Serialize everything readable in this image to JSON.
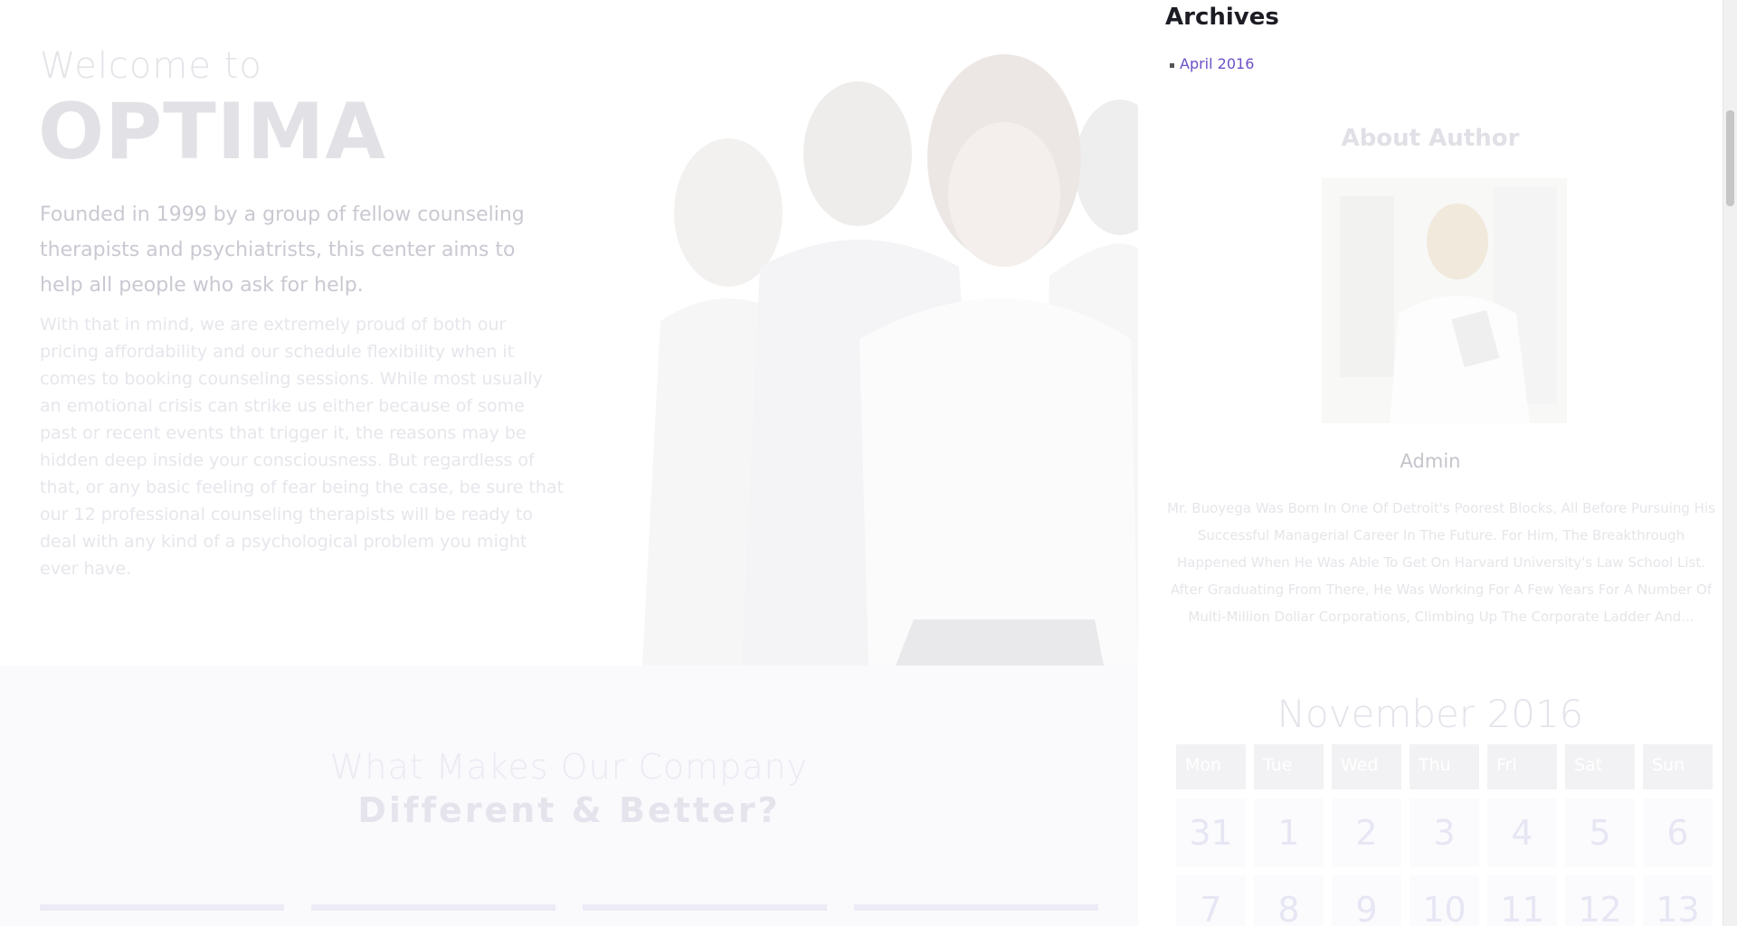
{
  "hero": {
    "welcome": "Welcome to",
    "brand": "OPTIMA",
    "lead": "Founded in 1999 by a group of fellow counseling therapists and psychiatrists, this center aims to help all people who ask for help.",
    "body": "With that in mind, we are extremely proud of both our pricing affordability and our schedule flexibility when it comes to booking counseling sessions. While most usually an emotional crisis can strike us either because of some past or recent events that trigger it, the reasons may be hidden deep inside your consciousness. But regardless of that, or any basic feeling of fear being the case, be sure that our 12 professional counseling therapists will be ready to deal with any kind of a psychological problem you might ever have."
  },
  "section": {
    "title": "What Makes Our Company",
    "subtitle": "Different & Better?"
  },
  "sidebar": {
    "archives_title": "Archives",
    "archive_items": [
      "April 2016"
    ],
    "about_title": "About Author",
    "author_name": "Admin",
    "author_bio": "Mr. Buoyega Was Born In One Of Detroit's Poorest Blocks, All Before Pursuing His Successful Managerial Career In The Future. For Him, The Breakthrough Happened When He Was Able To Get On Harvard University's Law School List. After Graduating From There, He Was Working For A Few Years For A Number Of Multi-Million Dollar Corporations, Climbing Up The Corporate Ladder And..."
  },
  "calendar": {
    "title": "November 2016",
    "weekdays": [
      "Mon",
      "Tue",
      "Wed",
      "Thu",
      "Fri",
      "Sat",
      "Sun"
    ],
    "week1": [
      "31",
      "1",
      "2",
      "3",
      "4",
      "5",
      "6"
    ],
    "week2": [
      "7",
      "8",
      "9",
      "10",
      "11",
      "12",
      "13"
    ]
  },
  "colors": {
    "accent": "#6b4fc7",
    "heading_dark": "#1c1c24"
  },
  "icons": {
    "archive_bullet": "square-bullet-icon"
  }
}
